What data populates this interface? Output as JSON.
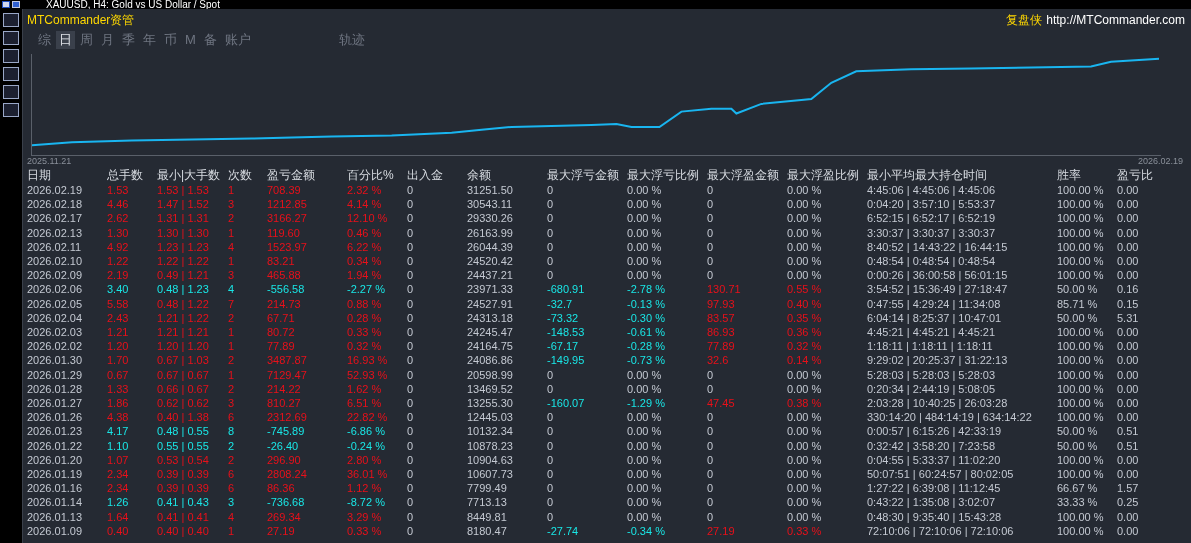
{
  "window": {
    "title": "XAUUSD, H4: Gold vs US Dollar / Spot"
  },
  "header": {
    "brand": "MTCommander资管",
    "right_label": "复盘侠",
    "url": "http://MTCommander.com"
  },
  "tabs": [
    {
      "label": "综",
      "selected": false
    },
    {
      "label": "日",
      "selected": true
    },
    {
      "label": "周",
      "selected": false
    },
    {
      "label": "月",
      "selected": false
    },
    {
      "label": "季",
      "selected": false
    },
    {
      "label": "年",
      "selected": false
    },
    {
      "label": "币",
      "selected": false
    },
    {
      "label": "M",
      "selected": false
    },
    {
      "label": "备",
      "selected": false
    },
    {
      "label": "账户",
      "selected": false
    },
    {
      "label": "轨迹",
      "selected": false
    }
  ],
  "equity_chart": {
    "start_label": "2025.11.21",
    "end_label": "2026.02.19"
  },
  "table": {
    "columns": [
      "日期",
      "总手数",
      "最小|大手数",
      "次数",
      "盈亏金额",
      "百分比%",
      "出入金",
      "余额",
      "最大浮亏金额",
      "最大浮亏比例",
      "最大浮盈金额",
      "最大浮盈比例",
      "最小平均最大持仓时间",
      "胜率",
      "盈亏比"
    ],
    "rows": [
      {
        "kind": "win",
        "floating": false,
        "cells": [
          "2026.02.19",
          "1.53",
          "1.53 | 1.53",
          "1",
          "708.39",
          "2.32 %",
          "0",
          "31251.50",
          "0",
          "0.00 %",
          "0",
          "0.00 %",
          "4:45:06 | 4:45:06 | 4:45:06",
          "100.00 %",
          "0.00"
        ]
      },
      {
        "kind": "win",
        "floating": false,
        "cells": [
          "2026.02.18",
          "4.46",
          "1.47 | 1.52",
          "3",
          "1212.85",
          "4.14 %",
          "0",
          "30543.11",
          "0",
          "0.00 %",
          "0",
          "0.00 %",
          "0:04:20 | 3:57:10 | 5:53:37",
          "100.00 %",
          "0.00"
        ]
      },
      {
        "kind": "win",
        "floating": false,
        "cells": [
          "2026.02.17",
          "2.62",
          "1.31 | 1.31",
          "2",
          "3166.27",
          "12.10 %",
          "0",
          "29330.26",
          "0",
          "0.00 %",
          "0",
          "0.00 %",
          "6:52:15 | 6:52:17 | 6:52:19",
          "100.00 %",
          "0.00"
        ]
      },
      {
        "kind": "win",
        "floating": false,
        "cells": [
          "2026.02.13",
          "1.30",
          "1.30 | 1.30",
          "1",
          "119.60",
          "0.46 %",
          "0",
          "26163.99",
          "0",
          "0.00 %",
          "0",
          "0.00 %",
          "3:30:37 | 3:30:37 | 3:30:37",
          "100.00 %",
          "0.00"
        ]
      },
      {
        "kind": "win",
        "floating": false,
        "cells": [
          "2026.02.11",
          "4.92",
          "1.23 | 1.23",
          "4",
          "1523.97",
          "6.22 %",
          "0",
          "26044.39",
          "0",
          "0.00 %",
          "0",
          "0.00 %",
          "8:40:52 | 14:43:22 | 16:44:15",
          "100.00 %",
          "0.00"
        ]
      },
      {
        "kind": "win",
        "floating": false,
        "cells": [
          "2026.02.10",
          "1.22",
          "1.22 | 1.22",
          "1",
          "83.21",
          "0.34 %",
          "0",
          "24520.42",
          "0",
          "0.00 %",
          "0",
          "0.00 %",
          "0:48:54 | 0:48:54 | 0:48:54",
          "100.00 %",
          "0.00"
        ]
      },
      {
        "kind": "win",
        "floating": false,
        "cells": [
          "2026.02.09",
          "2.19",
          "0.49 | 1.21",
          "3",
          "465.88",
          "1.94 %",
          "0",
          "24437.21",
          "0",
          "0.00 %",
          "0",
          "0.00 %",
          "0:00:26 | 36:00:58 | 56:01:15",
          "100.00 %",
          "0.00"
        ]
      },
      {
        "kind": "loss",
        "floating": true,
        "cells": [
          "2026.02.06",
          "3.40",
          "0.48 | 1.23",
          "4",
          "-556.58",
          "-2.27 %",
          "0",
          "23971.33",
          "-680.91",
          "-2.78 %",
          "130.71",
          "0.55 %",
          "3:54:52 | 15:36:49 | 27:18:47",
          "50.00 %",
          "0.16"
        ]
      },
      {
        "kind": "win",
        "floating": true,
        "cells": [
          "2026.02.05",
          "5.58",
          "0.48 | 1.22",
          "7",
          "214.73",
          "0.88 %",
          "0",
          "24527.91",
          "-32.7",
          "-0.13 %",
          "97.93",
          "0.40 %",
          "0:47:55 | 4:29:24 | 11:34:08",
          "85.71 %",
          "0.15"
        ]
      },
      {
        "kind": "win",
        "floating": true,
        "cells": [
          "2026.02.04",
          "2.43",
          "1.21 | 1.22",
          "2",
          "67.71",
          "0.28 %",
          "0",
          "24313.18",
          "-73.32",
          "-0.30 %",
          "83.57",
          "0.35 %",
          "6:04:14 | 8:25:37 | 10:47:01",
          "50.00 %",
          "5.31"
        ]
      },
      {
        "kind": "win",
        "floating": true,
        "cells": [
          "2026.02.03",
          "1.21",
          "1.21 | 1.21",
          "1",
          "80.72",
          "0.33 %",
          "0",
          "24245.47",
          "-148.53",
          "-0.61 %",
          "86.93",
          "0.36 %",
          "4:45:21 | 4:45:21 | 4:45:21",
          "100.00 %",
          "0.00"
        ]
      },
      {
        "kind": "win",
        "floating": true,
        "cells": [
          "2026.02.02",
          "1.20",
          "1.20 | 1.20",
          "1",
          "77.89",
          "0.32 %",
          "0",
          "24164.75",
          "-67.17",
          "-0.28 %",
          "77.89",
          "0.32 %",
          "1:18:11 | 1:18:11 | 1:18:11",
          "100.00 %",
          "0.00"
        ]
      },
      {
        "kind": "win",
        "floating": true,
        "cells": [
          "2026.01.30",
          "1.70",
          "0.67 | 1.03",
          "2",
          "3487.87",
          "16.93 %",
          "0",
          "24086.86",
          "-149.95",
          "-0.73 %",
          "32.6",
          "0.14 %",
          "9:29:02 | 20:25:37 | 31:22:13",
          "100.00 %",
          "0.00"
        ]
      },
      {
        "kind": "win",
        "floating": false,
        "cells": [
          "2026.01.29",
          "0.67",
          "0.67 | 0.67",
          "1",
          "7129.47",
          "52.93 %",
          "0",
          "20598.99",
          "0",
          "0.00 %",
          "0",
          "0.00 %",
          "5:28:03 | 5:28:03 | 5:28:03",
          "100.00 %",
          "0.00"
        ]
      },
      {
        "kind": "win",
        "floating": false,
        "cells": [
          "2026.01.28",
          "1.33",
          "0.66 | 0.67",
          "2",
          "214.22",
          "1.62 %",
          "0",
          "13469.52",
          "0",
          "0.00 %",
          "0",
          "0.00 %",
          "0:20:34 | 2:44:19 | 5:08:05",
          "100.00 %",
          "0.00"
        ]
      },
      {
        "kind": "win",
        "floating": true,
        "cells": [
          "2026.01.27",
          "1.86",
          "0.62 | 0.62",
          "3",
          "810.27",
          "6.51 %",
          "0",
          "13255.30",
          "-160.07",
          "-1.29 %",
          "47.45",
          "0.38 %",
          "2:03:28 | 10:40:25 | 26:03:28",
          "100.00 %",
          "0.00"
        ]
      },
      {
        "kind": "win",
        "floating": false,
        "cells": [
          "2026.01.26",
          "4.38",
          "0.40 | 1.38",
          "6",
          "2312.69",
          "22.82 %",
          "0",
          "12445.03",
          "0",
          "0.00 %",
          "0",
          "0.00 %",
          "330:14:20 | 484:14:19 | 634:14:22",
          "100.00 %",
          "0.00"
        ]
      },
      {
        "kind": "loss",
        "floating": false,
        "cells": [
          "2026.01.23",
          "4.17",
          "0.48 | 0.55",
          "8",
          "-745.89",
          "-6.86 %",
          "0",
          "10132.34",
          "0",
          "0.00 %",
          "0",
          "0.00 %",
          "0:00:57 | 6:15:26 | 42:33:19",
          "50.00 %",
          "0.51"
        ]
      },
      {
        "kind": "loss",
        "floating": false,
        "cells": [
          "2026.01.22",
          "1.10",
          "0.55 | 0.55",
          "2",
          "-26.40",
          "-0.24 %",
          "0",
          "10878.23",
          "0",
          "0.00 %",
          "0",
          "0.00 %",
          "0:32:42 | 3:58:20 | 7:23:58",
          "50.00 %",
          "0.51"
        ]
      },
      {
        "kind": "win",
        "floating": false,
        "cells": [
          "2026.01.20",
          "1.07",
          "0.53 | 0.54",
          "2",
          "296.90",
          "2.80 %",
          "0",
          "10904.63",
          "0",
          "0.00 %",
          "0",
          "0.00 %",
          "0:04:55 | 5:33:37 | 11:02:20",
          "100.00 %",
          "0.00"
        ]
      },
      {
        "kind": "win",
        "floating": false,
        "cells": [
          "2026.01.19",
          "2.34",
          "0.39 | 0.39",
          "6",
          "2808.24",
          "36.01 %",
          "0",
          "10607.73",
          "0",
          "0.00 %",
          "0",
          "0.00 %",
          "50:07:51 | 60:24:57 | 80:02:05",
          "100.00 %",
          "0.00"
        ]
      },
      {
        "kind": "win",
        "floating": false,
        "cells": [
          "2026.01.16",
          "2.34",
          "0.39 | 0.39",
          "6",
          "86.36",
          "1.12 %",
          "0",
          "7799.49",
          "0",
          "0.00 %",
          "0",
          "0.00 %",
          "1:27:22 | 6:39:08 | 11:12:45",
          "66.67 %",
          "1.57"
        ]
      },
      {
        "kind": "loss",
        "floating": false,
        "cells": [
          "2026.01.14",
          "1.26",
          "0.41 | 0.43",
          "3",
          "-736.68",
          "-8.72 %",
          "0",
          "7713.13",
          "0",
          "0.00 %",
          "0",
          "0.00 %",
          "0:43:22 | 1:35:08 | 3:02:07",
          "33.33 %",
          "0.25"
        ]
      },
      {
        "kind": "win",
        "floating": false,
        "cells": [
          "2026.01.13",
          "1.64",
          "0.41 | 0.41",
          "4",
          "269.34",
          "3.29 %",
          "0",
          "8449.81",
          "0",
          "0.00 %",
          "0",
          "0.00 %",
          "0:48:30 | 9:35:40 | 15:43:28",
          "100.00 %",
          "0.00"
        ]
      },
      {
        "kind": "win",
        "floating": true,
        "cells": [
          "2026.01.09",
          "0.40",
          "0.40 | 0.40",
          "1",
          "27.19",
          "0.33 %",
          "0",
          "8180.47",
          "-27.74",
          "-0.34 %",
          "27.19",
          "0.33 %",
          "72:10:06 | 72:10:06 | 72:10:06",
          "100.00 %",
          "0.00"
        ]
      }
    ]
  }
}
